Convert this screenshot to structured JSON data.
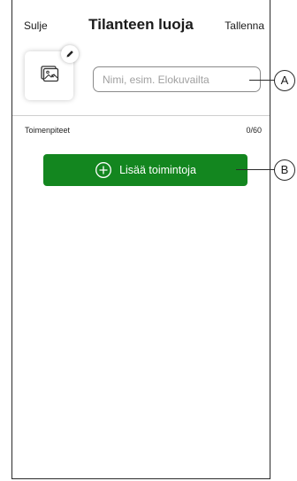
{
  "header": {
    "close_label": "Sulje",
    "title": "Tilanteen luoja",
    "save_label": "Tallenna"
  },
  "scene": {
    "icon_name": "scene-gallery-icon",
    "edit_icon_name": "pencil-icon",
    "name_placeholder": "Nimi, esim. Elokuvailta",
    "name_value": ""
  },
  "actions_section": {
    "label": "Toimenpiteet",
    "count": "0/60"
  },
  "add_button": {
    "icon_name": "plus-circle-icon",
    "label": "Lisää toimintoja"
  },
  "callouts": [
    "A",
    "B"
  ],
  "colors": {
    "accent_green": "#13861f",
    "border": "#2b2b2b"
  }
}
